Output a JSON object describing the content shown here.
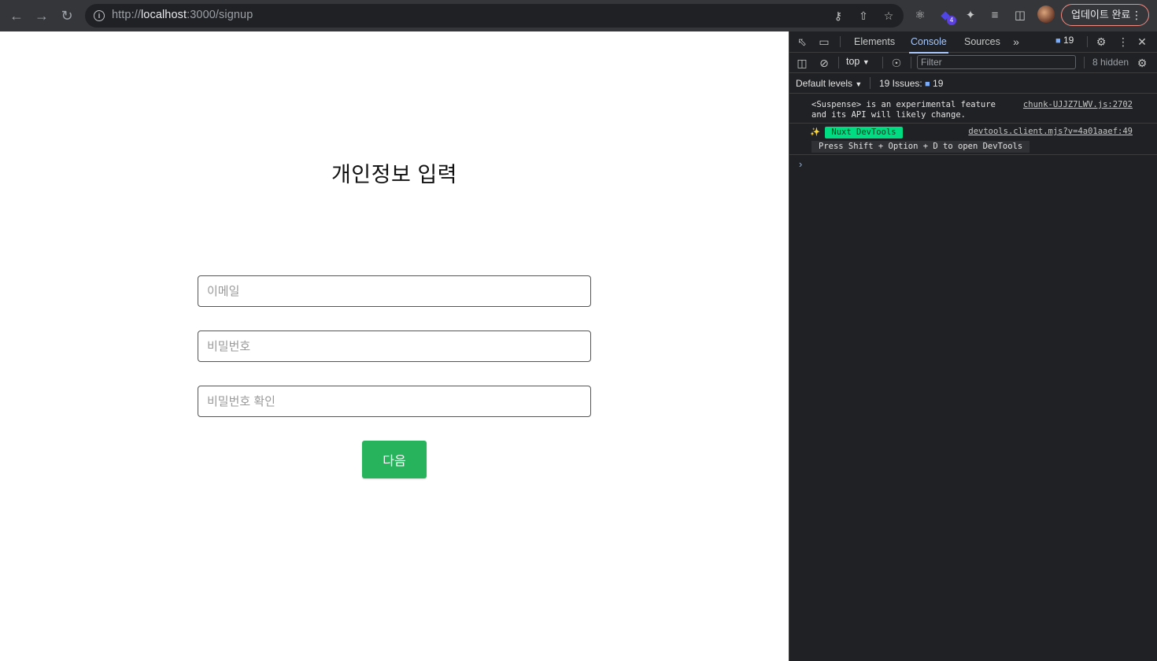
{
  "browser": {
    "url_prefix": "http://",
    "url_host": "localhost",
    "url_rest": ":3000/signup",
    "extension_badge": "4",
    "update_button_label": "업데이트 완료"
  },
  "page": {
    "title": "개인정보 입력",
    "fields": [
      {
        "placeholder": "이메일",
        "value": ""
      },
      {
        "placeholder": "비밀번호",
        "value": ""
      },
      {
        "placeholder": "비밀번호 확인",
        "value": ""
      }
    ],
    "next_button_label": "다음",
    "accent_color": "#27b35b"
  },
  "devtools": {
    "tabs": [
      "Elements",
      "Console",
      "Sources"
    ],
    "active_tab": "Console",
    "issue_badge_count": "19",
    "context": "top",
    "filter_placeholder": "Filter",
    "hidden_count": "8 hidden",
    "default_levels": "Default levels",
    "issues_label": "19 Issues:",
    "issues_count": "19",
    "messages": [
      {
        "text": "<Suspense> is an experimental feature\nand its API will likely change.",
        "source": "chunk-UJJZ7LWV.js:2702"
      },
      {
        "badge": "Nuxt DevTools",
        "text": "Press Shift + Option + D to open DevTools",
        "source": "devtools.client.mjs?v=4a01aaef:49"
      }
    ]
  }
}
